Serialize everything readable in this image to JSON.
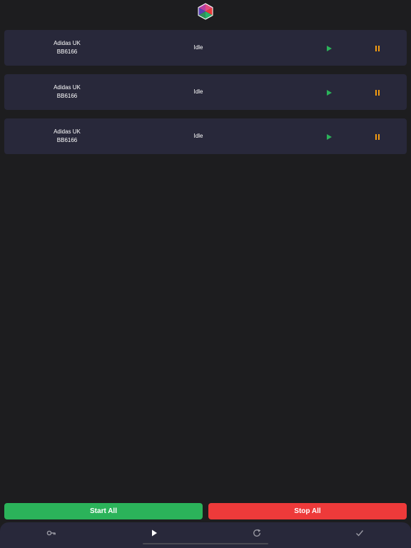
{
  "brand": {
    "logo_icon": "hexagon-cube-logo"
  },
  "tasks": [
    {
      "site": "Adidas UK",
      "sku": "BB6166",
      "status": "Idle"
    },
    {
      "site": "Adidas UK",
      "sku": "BB6166",
      "status": "Idle"
    },
    {
      "site": "Adidas UK",
      "sku": "BB6166",
      "status": "Idle"
    }
  ],
  "actions": {
    "start_all_label": "Start All",
    "stop_all_label": "Stop All"
  },
  "tab_bar": {
    "items": [
      {
        "icon": "key-icon"
      },
      {
        "icon": "play-icon"
      },
      {
        "icon": "refresh-icon"
      },
      {
        "icon": "check-icon"
      }
    ]
  },
  "colors": {
    "background": "#1d1d1f",
    "card": "#28283a",
    "play": "#2bb35a",
    "pause": "#f39c12",
    "start_button": "#2bb35a",
    "stop_button": "#ee3a3a"
  }
}
